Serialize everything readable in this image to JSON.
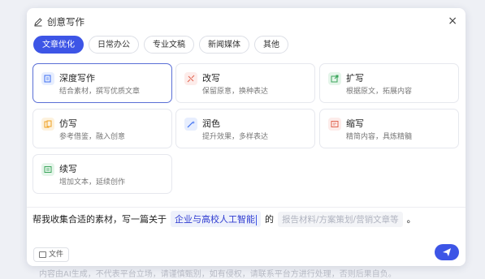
{
  "dialog": {
    "title": "创意写作",
    "close_label": "×"
  },
  "tabs": [
    {
      "label": "文章优化",
      "active": true
    },
    {
      "label": "日常办公",
      "active": false
    },
    {
      "label": "专业文稿",
      "active": false
    },
    {
      "label": "新闻媒体",
      "active": false
    },
    {
      "label": "其他",
      "active": false
    }
  ],
  "cards": [
    {
      "name": "深度写作",
      "desc": "结合素材，撰写优质文章",
      "icon": "doc-edit-icon",
      "color": "#3c6ff2",
      "bg": "#e7eefe"
    },
    {
      "name": "改写",
      "desc": "保留原意，换种表达",
      "icon": "rewrite-icon",
      "color": "#e0634f",
      "bg": "#fdecea"
    },
    {
      "name": "扩写",
      "desc": "根据原文，拓展内容",
      "icon": "expand-icon",
      "color": "#3aa55b",
      "bg": "#e5f5ea"
    },
    {
      "name": "仿写",
      "desc": "参考借鉴，融入创意",
      "icon": "imitate-icon",
      "color": "#f0a020",
      "bg": "#fdf2de"
    },
    {
      "name": "润色",
      "desc": "提升效果，多样表达",
      "icon": "polish-icon",
      "color": "#3c6ff2",
      "bg": "#e7eefe"
    },
    {
      "name": "缩写",
      "desc": "精简内容，具炼精髓",
      "icon": "abbreviate-icon",
      "color": "#e0634f",
      "bg": "#fdecea"
    },
    {
      "name": "续写",
      "desc": "增加文本，延续创作",
      "icon": "continue-icon",
      "color": "#3aa55b",
      "bg": "#e5f5ea"
    }
  ],
  "prompt": {
    "prefix": "帮我收集合适的素材，写一篇关于",
    "topic": "企业与高校人工智能",
    "connector": "的",
    "placeholder": "报告材料/方案策划/营销文章等",
    "suffix": "。"
  },
  "footer": {
    "file_label": "文件"
  },
  "backdrop": {
    "text": "内容由AI生成，不代表平台立场，请谨慎甄别，如有侵权，请联系平台方进行处理，否则后果自负。"
  }
}
